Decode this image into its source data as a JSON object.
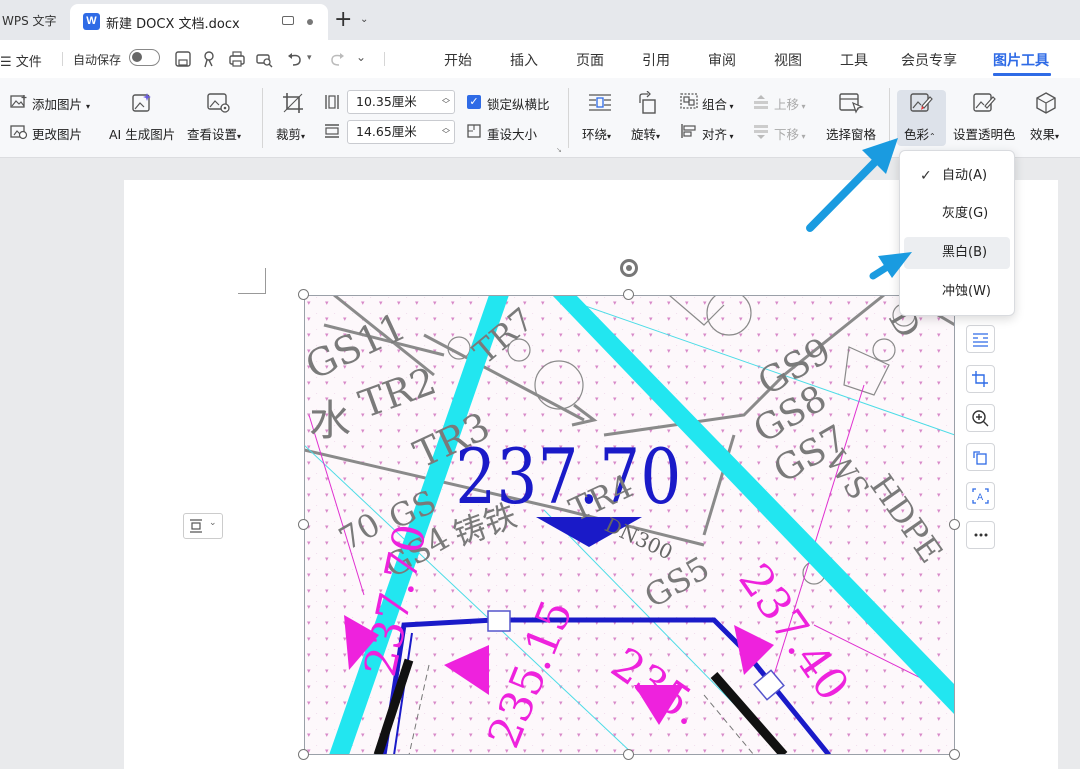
{
  "tabs": {
    "app_tab": "WPS 文字",
    "doc_tab": "新建 DOCX 文档.docx",
    "doc_icon": "W",
    "new_tab": "+"
  },
  "menubar": {
    "file": "☰ 文件",
    "autosave": "自动保存",
    "items": [
      "开始",
      "插入",
      "页面",
      "引用",
      "审阅",
      "视图",
      "工具",
      "会员专享",
      "图片工具"
    ]
  },
  "ribbon": {
    "add_image": "添加图片",
    "change_image": "更改图片",
    "ai_generate": "AI 生成图片",
    "view_settings": "查看设置",
    "crop": "裁剪",
    "width": "10.35厘米",
    "height": "14.65厘米",
    "lock_ratio": "锁定纵横比",
    "reset_size": "重设大小",
    "wrap": "环绕",
    "rotate": "旋转",
    "group": "组合",
    "align": "对齐",
    "move_up": "上移",
    "move_down": "下移",
    "selection_pane": "选择窗格",
    "color": "色彩",
    "set_transparent": "设置透明色",
    "effects": "效果"
  },
  "color_menu": {
    "items": [
      "自动(A)",
      "灰度(G)",
      "黑白(B)",
      "冲蚀(W)"
    ],
    "checked_index": 0,
    "hover_index": 2
  },
  "drawing": {
    "labels_blue": [
      "237.70",
      "DN300"
    ],
    "labels_gray": [
      "GS11",
      "TR2",
      "TR3",
      "TR7",
      "GS9",
      "GS8",
      "GS7",
      "GS4",
      "GS5",
      "TR4",
      "WS",
      "HDPE",
      "水",
      "铸铁",
      "GS",
      "70",
      "D"
    ],
    "labels_magenta": [
      "237.70",
      "237.40",
      "235.15",
      "235."
    ]
  },
  "colors": {
    "accent": "#2f6be6",
    "cyan": "#22e6f0",
    "magenta": "#ee22dd",
    "blue_line": "#1a1ac8",
    "arrow": "#1a9be0"
  }
}
